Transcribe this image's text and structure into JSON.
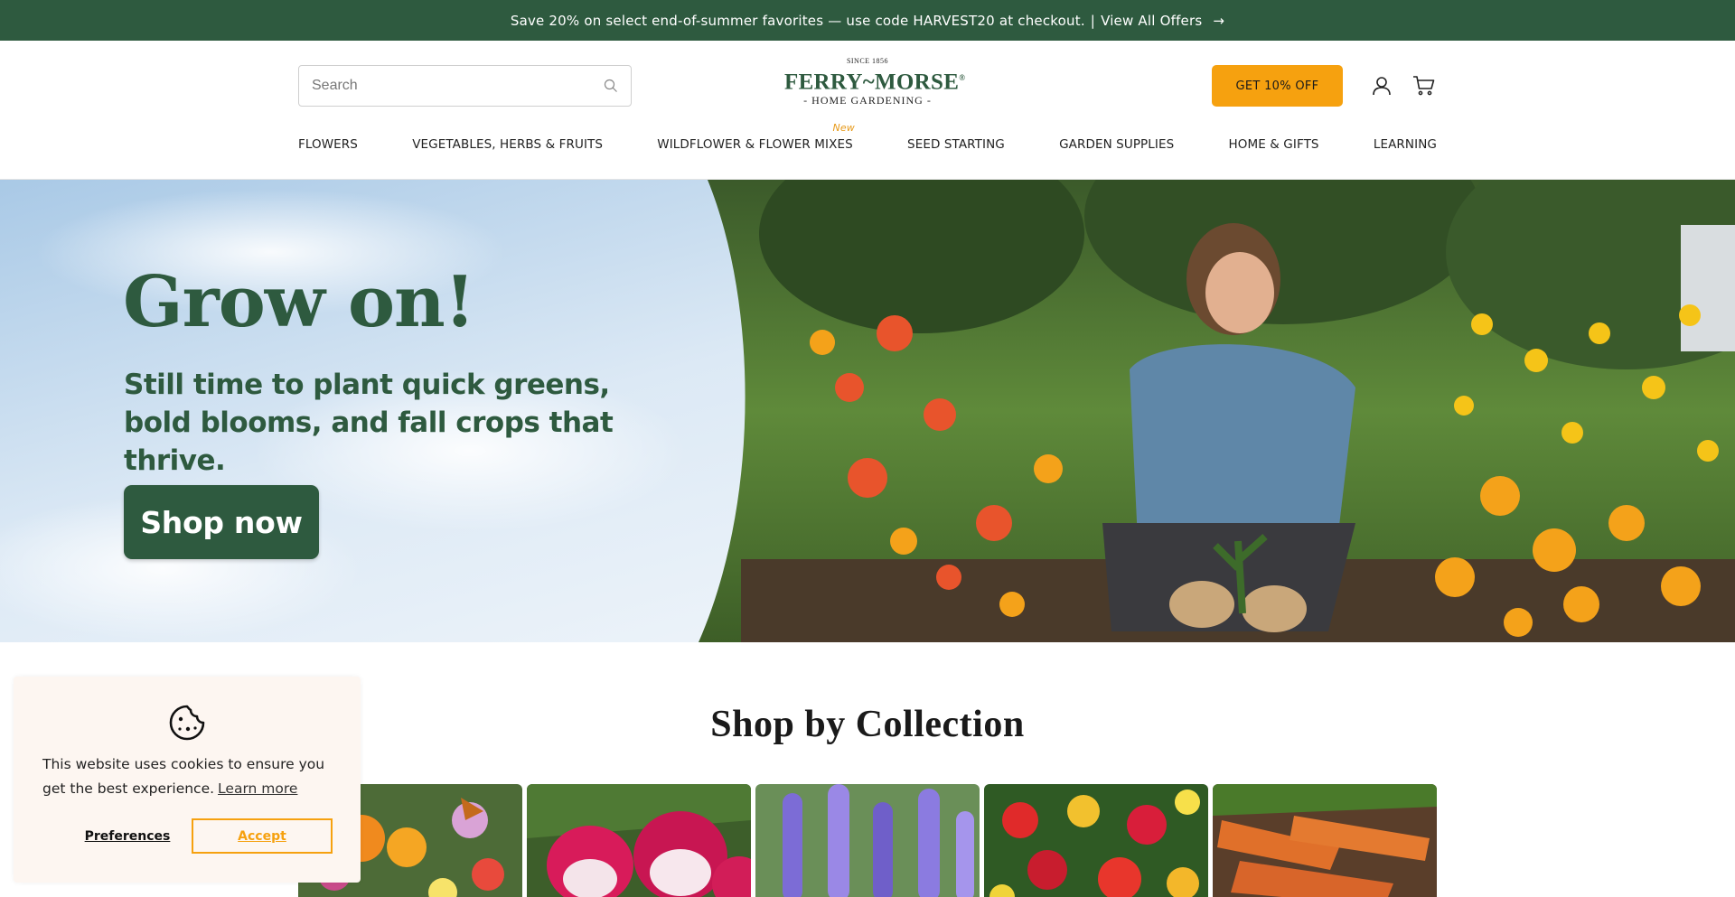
{
  "announcement": {
    "text": "Save 20% on select end-of-summer favorites — use code HARVEST20 at checkout.",
    "separator": "|",
    "link_label": "View All Offers",
    "arrow": "→"
  },
  "header": {
    "search_placeholder": "Search",
    "logo": {
      "since": "SINCE 1856",
      "brand": "FERRY~MORSE",
      "registered": "®",
      "tagline": "- HOME GARDENING -"
    },
    "cta_label": "GET 10% OFF",
    "icons": [
      "search-icon",
      "account-icon",
      "cart-icon"
    ]
  },
  "nav": {
    "items": [
      {
        "label": "FLOWERS"
      },
      {
        "label": "VEGETABLES, HERBS & FRUITS"
      },
      {
        "label": "WILDFLOWER & FLOWER MIXES",
        "badge": "New"
      },
      {
        "label": "SEED STARTING"
      },
      {
        "label": "GARDEN SUPPLIES"
      },
      {
        "label": "HOME & GIFTS"
      },
      {
        "label": "LEARNING"
      }
    ]
  },
  "hero": {
    "title": "Grow on!",
    "subtitle_line1": "Still time to plant quick greens,",
    "subtitle_line2": "bold blooms, and fall crops that thrive.",
    "button_label": "Shop now"
  },
  "collections": {
    "title": "Shop by Collection",
    "tiles": [
      "wildflower-mix-image",
      "radish-image",
      "lupine-image",
      "zinnia-image",
      "carrot-image"
    ]
  },
  "cookie_banner": {
    "message": "This website uses cookies to ensure you get the best experience.",
    "learn_more": "Learn more",
    "preferences_label": "Preferences",
    "accept_label": "Accept"
  },
  "colors": {
    "brand_green": "#2e5a3f",
    "accent_orange": "#f6a10f",
    "cookie_bg": "#fdf6f1"
  }
}
